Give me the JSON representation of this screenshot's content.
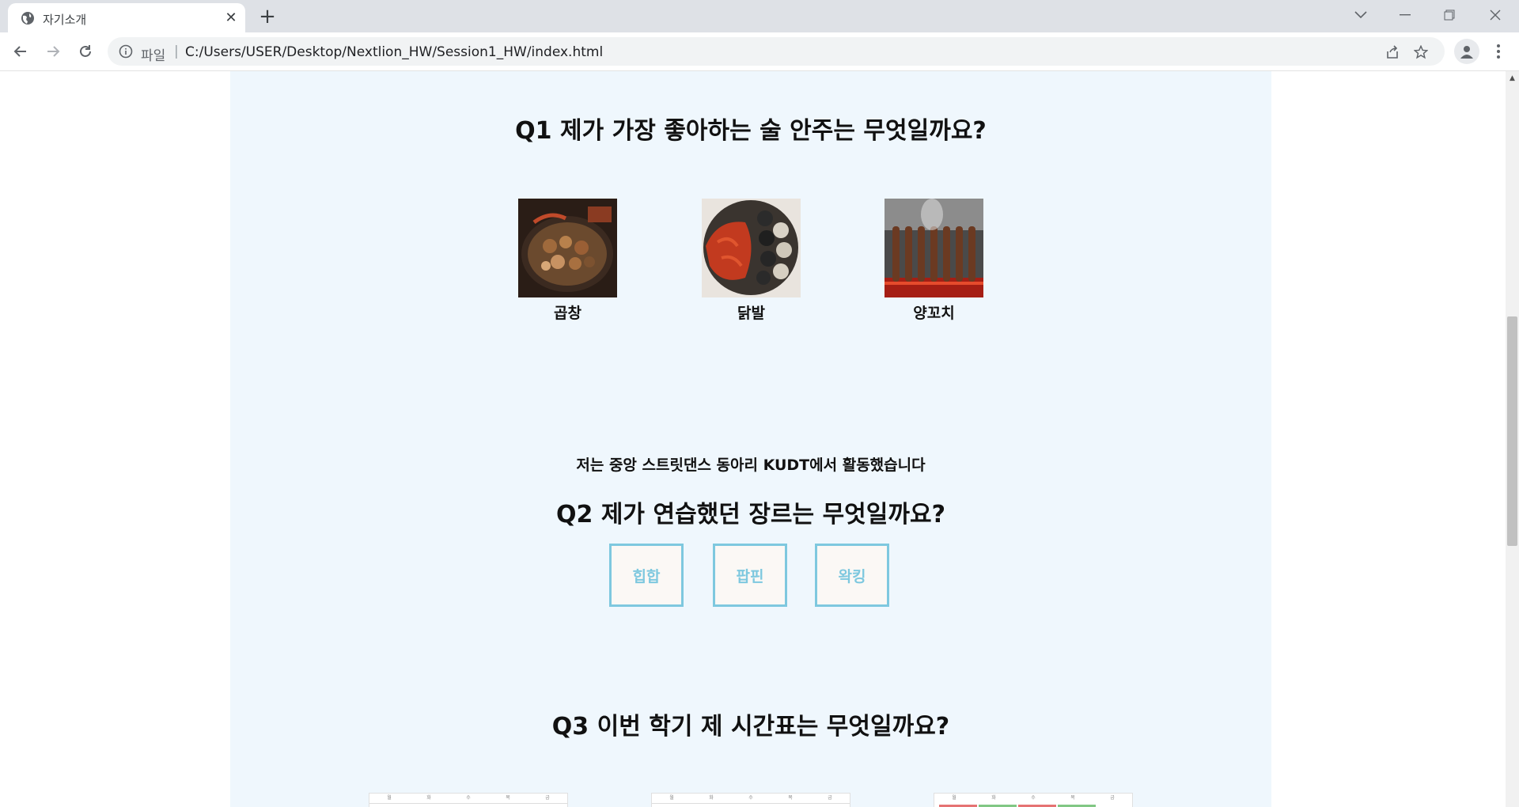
{
  "browser": {
    "tab_title": "자기소개",
    "address_scheme_label": "파일",
    "url": "C:/Users/USER/Desktop/Nextlion_HW/Session1_HW/index.html"
  },
  "page": {
    "q1": {
      "title": "Q1 제가 가장 좋아하는 술 안주는 무엇일까요?",
      "options": [
        {
          "label": "곱창"
        },
        {
          "label": "닭발"
        },
        {
          "label": "양꼬치"
        }
      ]
    },
    "intro_text": "저는 중앙 스트릿댄스 동아리 KUDT에서 활동했습니다",
    "q2": {
      "title": "Q2 제가 연습했던 장르는 무엇일까요?",
      "buttons": [
        "힙합",
        "팝핀",
        "왁킹"
      ],
      "button_color": "#7ec8df"
    },
    "q3": {
      "title": "Q3 이번 학기 제 시간표는 무엇일까요?",
      "timetable_days": [
        "월",
        "화",
        "수",
        "목",
        "금"
      ]
    },
    "colors": {
      "panel_bg": "#eff7fd",
      "accent": "#7ec8df"
    }
  }
}
